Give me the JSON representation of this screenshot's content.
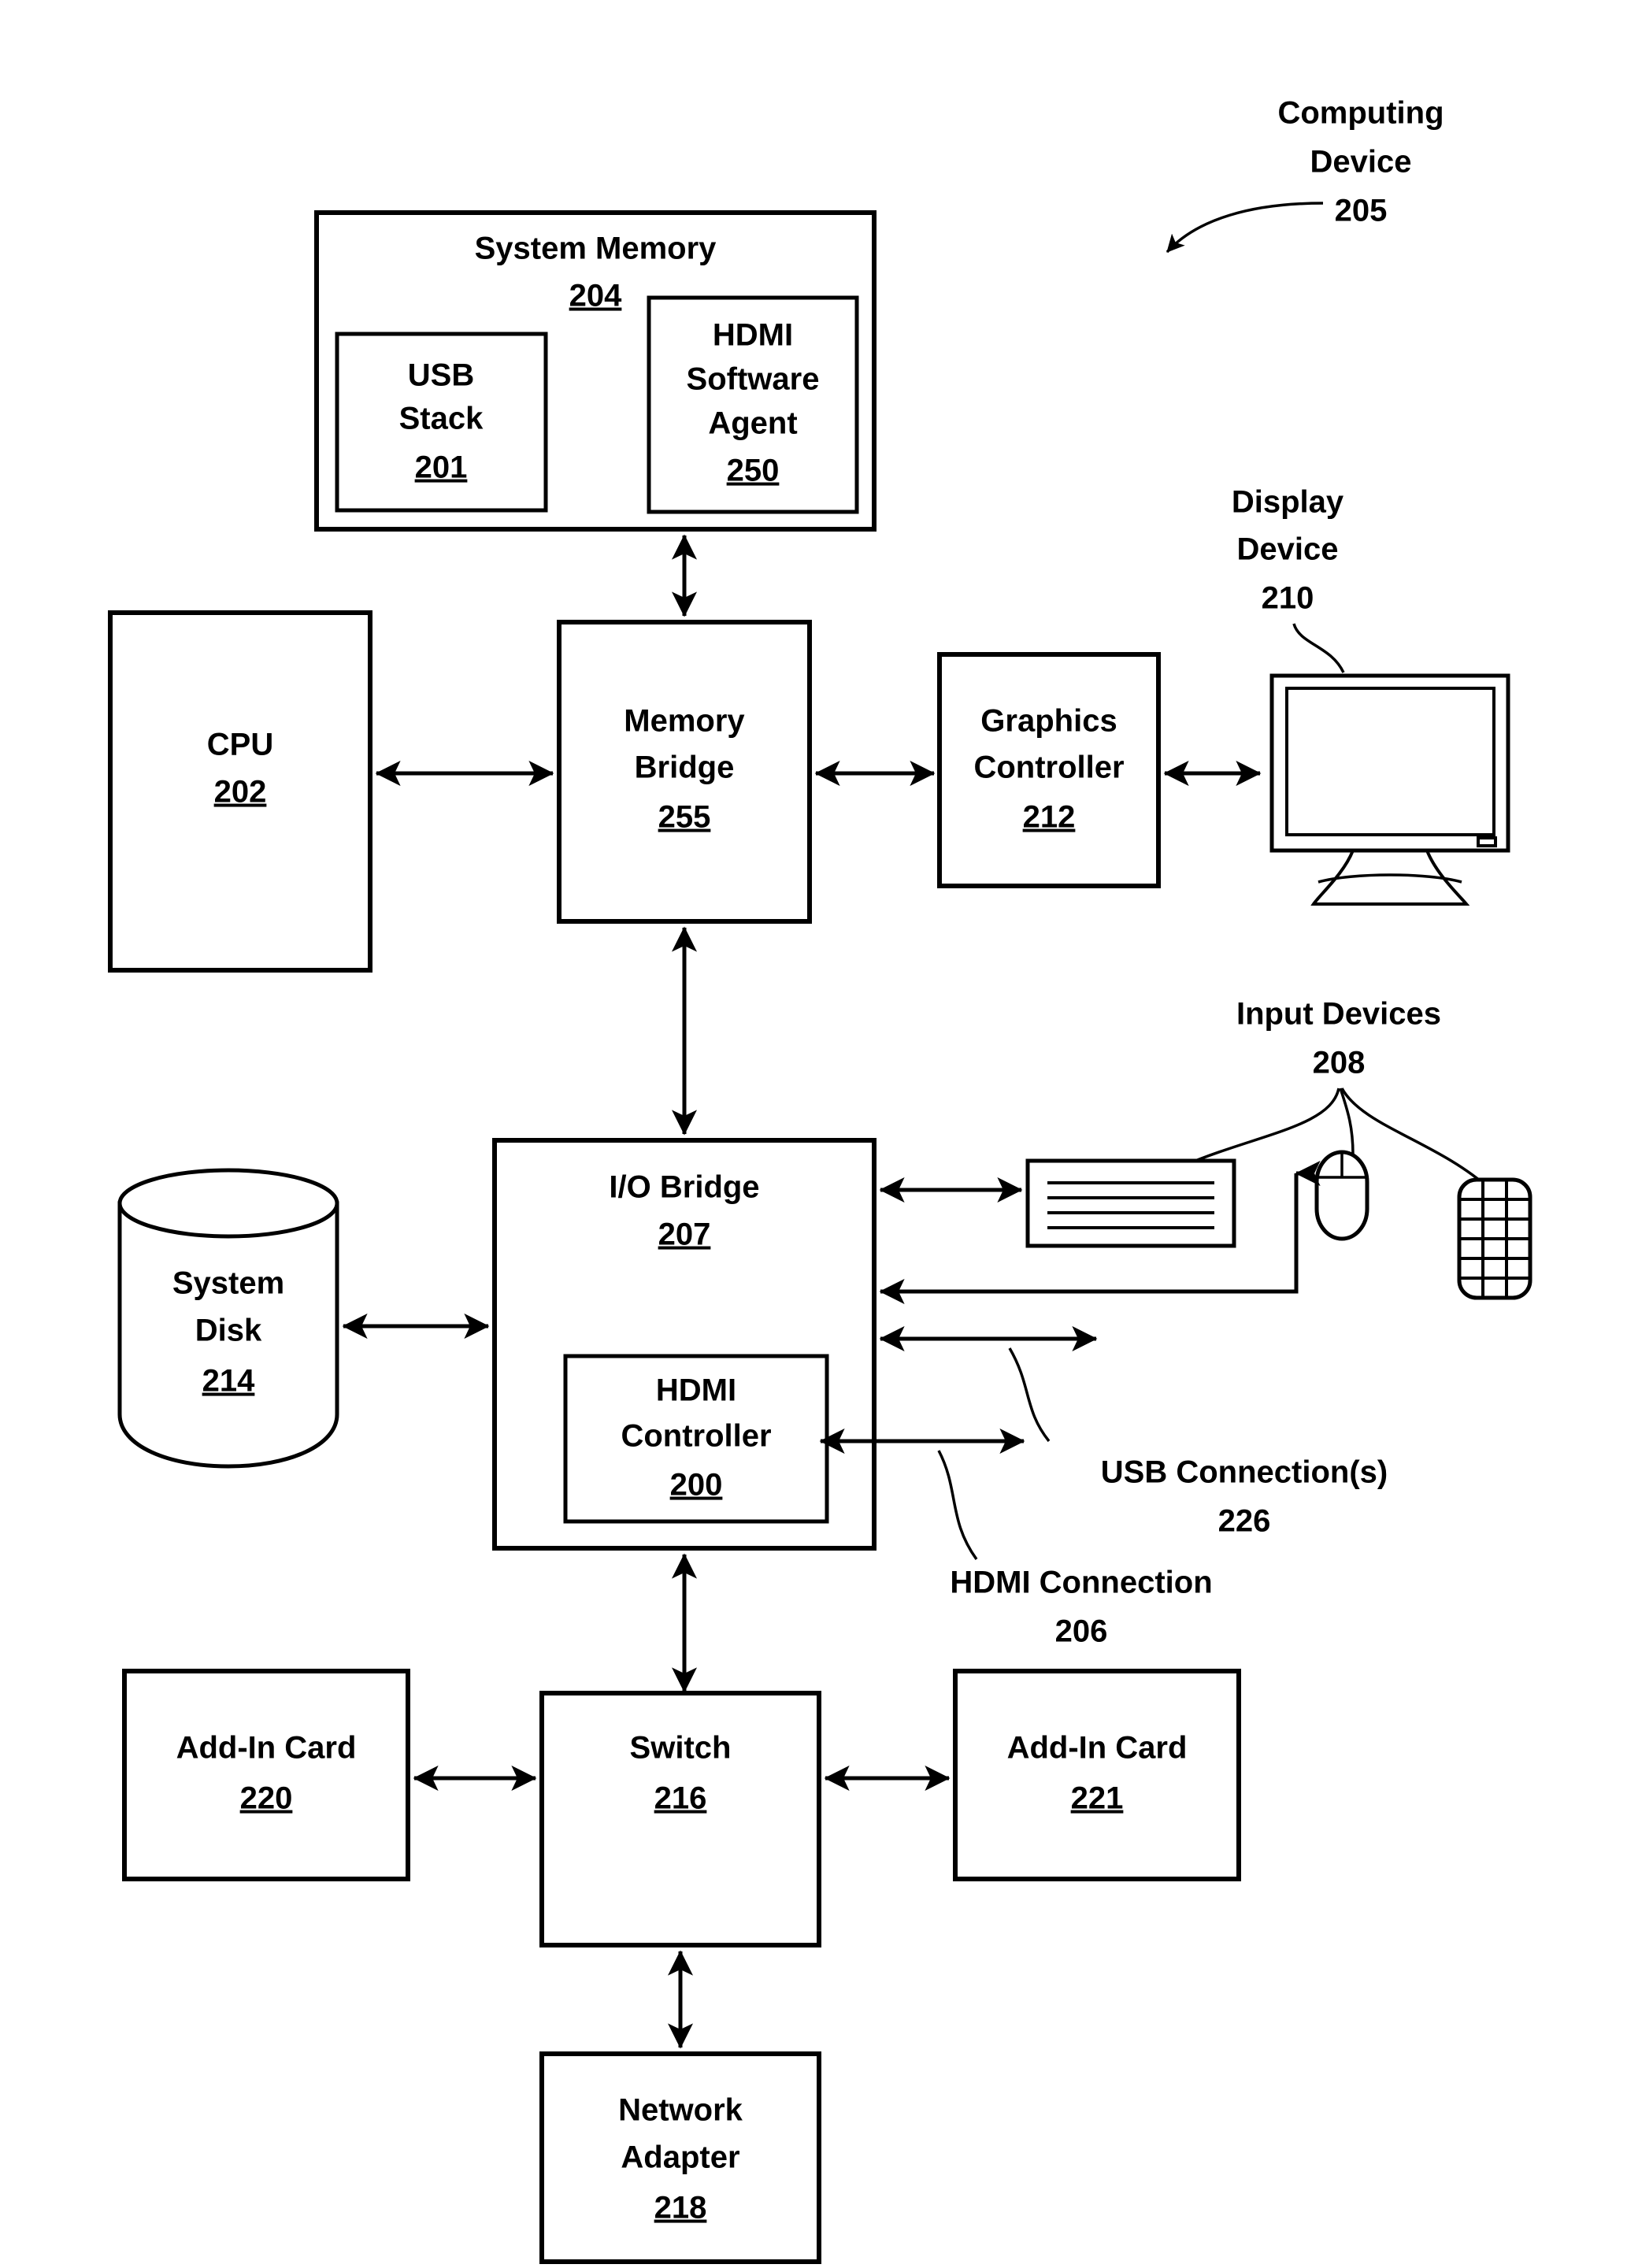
{
  "figure": {
    "title": "Computing Device Block Diagram",
    "stroke_color": "#000000",
    "background_color": "#ffffff"
  },
  "callouts": {
    "computing_device": {
      "line1": "Computing",
      "line2": "Device",
      "ref": "205"
    },
    "display_device": {
      "line1": "Display",
      "line2": "Device",
      "ref": "210"
    },
    "input_devices": {
      "line1": "Input Devices",
      "ref": "208"
    },
    "usb_connections": {
      "line1": "USB Connection(s)",
      "ref": "226"
    },
    "hdmi_connection": {
      "line1": "HDMI Connection",
      "ref": "206"
    }
  },
  "blocks": {
    "system_memory": {
      "label": "System Memory",
      "ref": "204"
    },
    "usb_stack": {
      "line1": "USB",
      "line2": "Stack",
      "ref": "201"
    },
    "hdmi_software_agent": {
      "line1": "HDMI",
      "line2": "Software",
      "line3": "Agent",
      "ref": "250"
    },
    "cpu": {
      "label": "CPU",
      "ref": "202"
    },
    "memory_bridge": {
      "line1": "Memory",
      "line2": "Bridge",
      "ref": "255"
    },
    "graphics_controller": {
      "line1": "Graphics",
      "line2": "Controller",
      "ref": "212"
    },
    "io_bridge": {
      "label": "I/O Bridge",
      "ref": "207"
    },
    "hdmi_controller": {
      "line1": "HDMI",
      "line2": "Controller",
      "ref": "200"
    },
    "system_disk": {
      "line1": "System",
      "line2": "Disk",
      "ref": "214"
    },
    "switch": {
      "label": "Switch",
      "ref": "216"
    },
    "add_in_card_left": {
      "label": "Add-In Card",
      "ref": "220"
    },
    "add_in_card_right": {
      "label": "Add-In Card",
      "ref": "221"
    },
    "network_adapter": {
      "line1": "Network",
      "line2": "Adapter",
      "ref": "218"
    }
  },
  "icons": {
    "monitor": "display-monitor-icon",
    "keyboard": "keyboard-icon",
    "mouse": "mouse-icon",
    "keypad": "keypad-icon",
    "disk_cylinder": "disk-cylinder-icon"
  },
  "connections": [
    {
      "from": "system_memory",
      "to": "memory_bridge",
      "style": "bidirectional-vertical"
    },
    {
      "from": "cpu",
      "to": "memory_bridge",
      "style": "bidirectional-horizontal"
    },
    {
      "from": "memory_bridge",
      "to": "graphics_controller",
      "style": "bidirectional-horizontal"
    },
    {
      "from": "graphics_controller",
      "to": "display_device",
      "style": "bidirectional-horizontal"
    },
    {
      "from": "memory_bridge",
      "to": "io_bridge",
      "style": "bidirectional-vertical"
    },
    {
      "from": "system_disk",
      "to": "io_bridge",
      "style": "bidirectional-horizontal"
    },
    {
      "from": "io_bridge",
      "to": "keyboard",
      "style": "bidirectional-horizontal"
    },
    {
      "from": "mouse",
      "to": "io_bridge",
      "style": "unidirectional-routed"
    },
    {
      "from": "io_bridge",
      "to": "usb_connections",
      "style": "bidirectional-horizontal"
    },
    {
      "from": "hdmi_controller",
      "to": "hdmi_connection",
      "style": "bidirectional-horizontal"
    },
    {
      "from": "io_bridge",
      "to": "switch",
      "style": "bidirectional-vertical"
    },
    {
      "from": "add_in_card_left",
      "to": "switch",
      "style": "bidirectional-horizontal"
    },
    {
      "from": "switch",
      "to": "add_in_card_right",
      "style": "bidirectional-horizontal"
    },
    {
      "from": "switch",
      "to": "network_adapter",
      "style": "bidirectional-vertical"
    }
  ]
}
